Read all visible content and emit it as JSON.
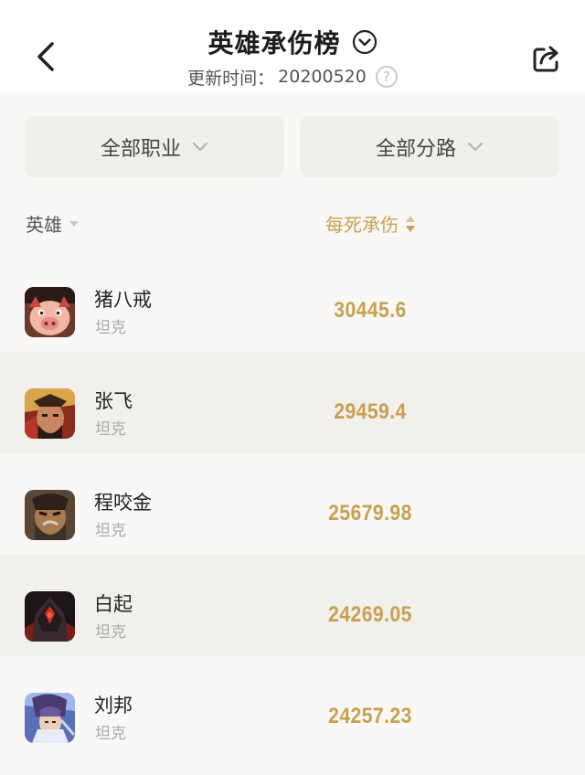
{
  "header": {
    "title": "英雄承伤榜",
    "update_label": "更新时间：",
    "update_value": "20200520",
    "help_glyph": "?"
  },
  "filters": {
    "profession": "全部职业",
    "lane": "全部分路"
  },
  "columns": {
    "hero": "英雄",
    "damage": "每死承伤"
  },
  "colors": {
    "accent": "#c9a04e",
    "row_alt": "#f2f0ed"
  },
  "heroes": [
    {
      "name": "猪八戒",
      "role": "坦克",
      "damage": "30445.6"
    },
    {
      "name": "张飞",
      "role": "坦克",
      "damage": "29459.4"
    },
    {
      "name": "程咬金",
      "role": "坦克",
      "damage": "25679.98"
    },
    {
      "name": "白起",
      "role": "坦克",
      "damage": "24269.05"
    },
    {
      "name": "刘邦",
      "role": "坦克",
      "damage": "24257.23"
    }
  ]
}
